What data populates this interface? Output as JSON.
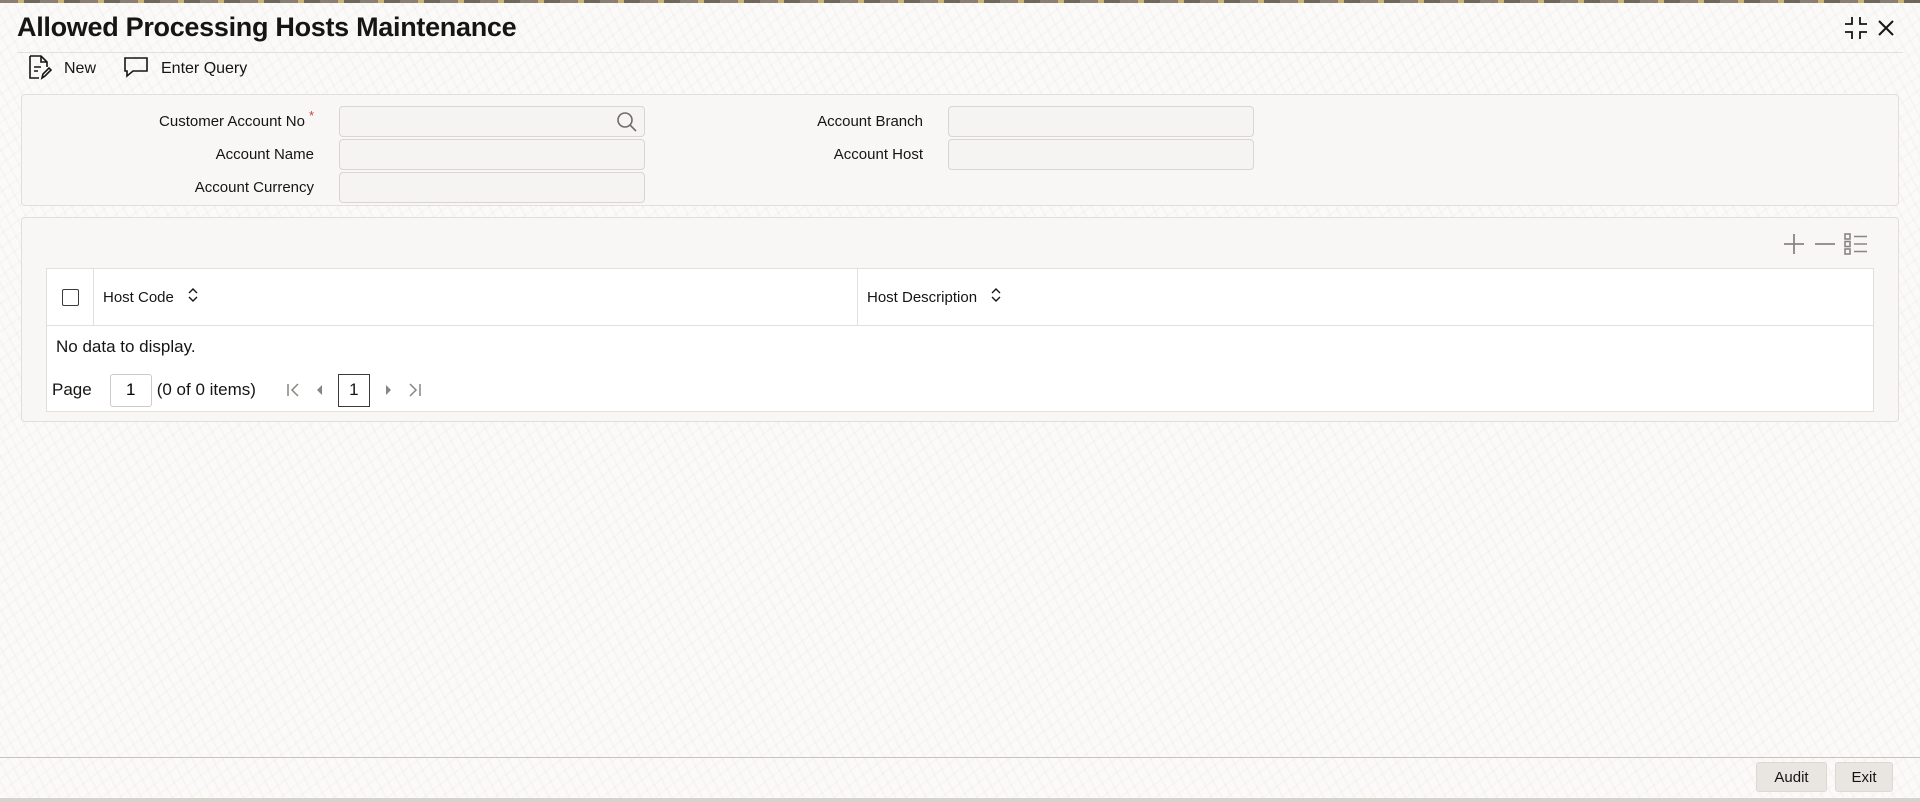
{
  "window": {
    "title": "Allowed Processing Hosts Maintenance",
    "icons": [
      "collapse-icon",
      "close-icon"
    ]
  },
  "toolbar": {
    "new_label": "New",
    "enter_query_label": "Enter Query"
  },
  "form": {
    "customer_account_no_label": "Customer Account No",
    "required_mark": "*",
    "account_name_label": "Account Name",
    "account_currency_label": "Account Currency",
    "account_branch_label": "Account Branch",
    "account_host_label": "Account Host",
    "customer_account_no_value": "",
    "account_name_value": "",
    "account_currency_value": "",
    "account_branch_value": "",
    "account_host_value": ""
  },
  "grid": {
    "columns": [
      "Host Code",
      "Host Description"
    ],
    "rows": [],
    "empty_text": "No data to display.",
    "tools": [
      "add-row-icon",
      "remove-row-icon",
      "single-record-view-icon"
    ]
  },
  "pagination": {
    "page_label": "Page",
    "page_value": "1",
    "items_summary": "(0 of 0 items)",
    "current_page": "1"
  },
  "footer": {
    "audit_label": "Audit",
    "exit_label": "Exit"
  },
  "colors": {
    "required": "#c74634",
    "panel_bg": "#f8f7f6",
    "text": "#161513"
  }
}
